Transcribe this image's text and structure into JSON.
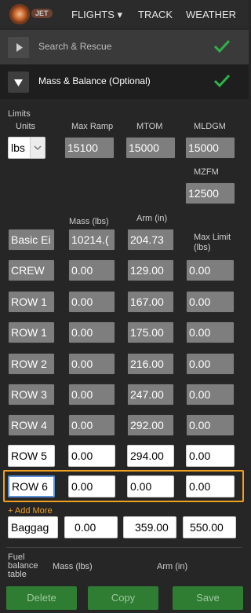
{
  "header": {
    "logo_text": "JET",
    "nav": [
      {
        "label": "FLIGHTS ▾"
      },
      {
        "label": "TRACK"
      },
      {
        "label": "WEATHER"
      }
    ]
  },
  "sections": {
    "search_rescue": {
      "label": "Search & Rescue",
      "complete": true
    },
    "mass_balance": {
      "label": "Mass & Balance (Optional)",
      "complete": true
    }
  },
  "limits": {
    "title": "Limits",
    "units_label": "Units",
    "units_value": "lbs",
    "max_ramp_label": "Max Ramp",
    "max_ramp_value": "15100",
    "mtom_label": "MTOM",
    "mtom_value": "15000",
    "mldgm_label": "MLDGM",
    "mldgm_value": "15000",
    "mzfm_label": "MZFM",
    "mzfm_value": "12500"
  },
  "table": {
    "headers": {
      "mass": "Mass (lbs)",
      "arm": "Arm (in)",
      "max_limit": "Max Limit (lbs)"
    },
    "rows": [
      {
        "name": "Basic Ei",
        "mass": "10214.(",
        "arm": "204.73",
        "limit": ""
      },
      {
        "name": "CREW",
        "mass": "0.00",
        "arm": "129.00",
        "limit": "0.00"
      },
      {
        "name": "ROW 1",
        "mass": "0.00",
        "arm": "167.00",
        "limit": "0.00"
      },
      {
        "name": "ROW 1",
        "mass": "0.00",
        "arm": "175.00",
        "limit": "0.00"
      },
      {
        "name": "ROW 2",
        "mass": "0.00",
        "arm": "216.00",
        "limit": "0.00"
      },
      {
        "name": "ROW 3",
        "mass": "0.00",
        "arm": "247.00",
        "limit": "0.00"
      },
      {
        "name": "ROW 4",
        "mass": "0.00",
        "arm": "292.00",
        "limit": "0.00"
      },
      {
        "name": "ROW 5",
        "mass": "0.00",
        "arm": "294.00",
        "limit": "0.00"
      },
      {
        "name": "ROW 6",
        "mass": "0.00",
        "arm": "0.00",
        "limit": "0.00"
      }
    ],
    "add_more": "+ Add More",
    "baggage": {
      "name": "Baggag",
      "mass": "0.00",
      "arm": "359.00",
      "limit": "550.00"
    }
  },
  "fuel": {
    "label": "Fuel balance table",
    "mass_label": "Mass (lbs)",
    "arm_label": "Arm (in)"
  },
  "buttons": {
    "delete": "Delete",
    "copy": "Copy",
    "save": "Save"
  },
  "colors": {
    "accent": "#f0a020",
    "check": "#2db34a",
    "button_green": "#2e7d32"
  }
}
